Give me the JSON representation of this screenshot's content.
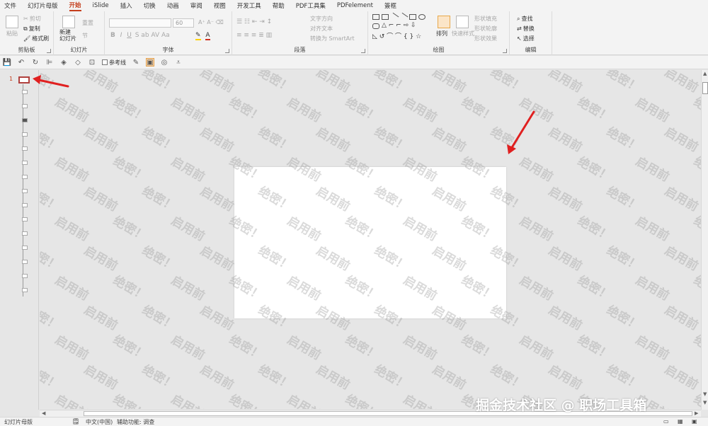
{
  "tabs": [
    "文件",
    "幻灯片母版",
    "开始",
    "iSlide",
    "插入",
    "切换",
    "动画",
    "审阅",
    "视图",
    "开发工具",
    "帮助",
    "PDF工具集",
    "PDFelement",
    "簽框"
  ],
  "clipboard": {
    "cut": "剪切",
    "copy": "复制",
    "paste": "粘贴",
    "format_painter": "格式刷",
    "label": "剪贴板"
  },
  "slides_group": {
    "new_slide": "新建\n幻灯片",
    "reset": "重置",
    "section": "节",
    "label": "幻灯片"
  },
  "font": {
    "size": "60",
    "label": "字体"
  },
  "paragraph": {
    "text_direction": "文字方向",
    "align_text": "对齐文本",
    "smartart": "转换为 SmartArt",
    "label": "段落"
  },
  "drawing": {
    "arrange": "排列",
    "quick_styles": "快速样式",
    "fill": "形状填充",
    "outline": "形状轮廓",
    "effects": "形状效果",
    "label": "绘图"
  },
  "editing": {
    "find": "查找",
    "replace": "替换",
    "select": "选择",
    "label": "编辑"
  },
  "qat": {
    "guides": "参考线"
  },
  "thumbnail": {
    "number": "1"
  },
  "watermark": {
    "text1": "绝密！",
    "text2": "启用前"
  },
  "status": {
    "mode": "幻灯片母版",
    "language": "中文(中国)",
    "accessibility": "辅助功能: 调查"
  },
  "credit": "掘金技术社区 @ 职场工具箱",
  "colors": {
    "accent": "#c43e1c",
    "arrow": "#e02020"
  }
}
